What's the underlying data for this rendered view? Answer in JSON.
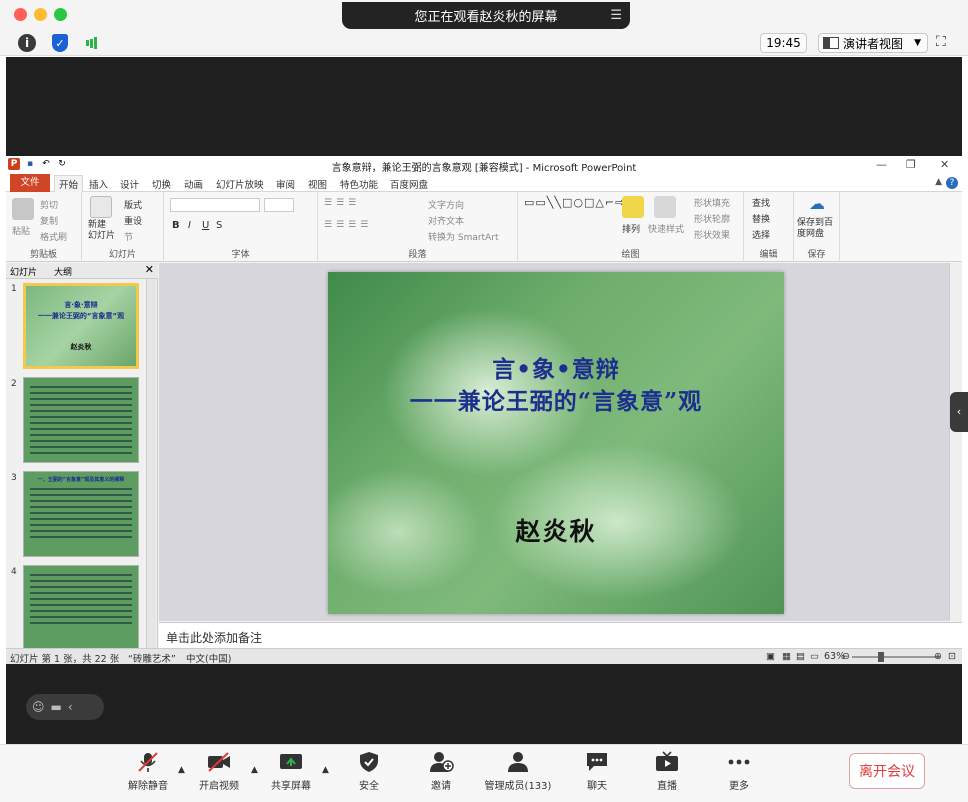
{
  "zoom": {
    "share_banner": "您正在观看赵炎秋的屏幕",
    "clock": "19:45",
    "view_mode": "演讲者视图",
    "leave_label": "离开会议",
    "controls": {
      "unmute": "解除静音",
      "start_video": "开启视频",
      "share_screen": "共享屏幕",
      "security": "安全",
      "invite": "邀请",
      "participants": "管理成员(133)",
      "chat": "聊天",
      "live": "直播",
      "more": "更多"
    }
  },
  "ppt": {
    "doc_title": "言象意辩，兼论王弼的言象意观 [兼容模式] - Microsoft PowerPoint",
    "tabs": {
      "file": "文件",
      "home": "开始",
      "insert": "插入",
      "design": "设计",
      "transitions": "切换",
      "animations": "动画",
      "slideshow": "幻灯片放映",
      "review": "审阅",
      "view": "视图",
      "features": "特色功能",
      "baidu": "百度网盘"
    },
    "ribbon": {
      "paste": "粘贴",
      "cut": "剪切",
      "copy": "复制",
      "format_painter": "格式刷",
      "clipboard": "剪贴板",
      "new_slide": "新建\n幻灯片",
      "layout": "版式",
      "reset": "重设",
      "section": "节",
      "slides_group": "幻灯片",
      "font_group": "字体",
      "text_direction": "文字方向",
      "align_text": "对齐文本",
      "smartart": "转换为 SmartArt",
      "paragraph_group": "段落",
      "arrange": "排列",
      "quick_styles": "快速样式",
      "shape_fill": "形状填充",
      "shape_outline": "形状轮廓",
      "shape_effects": "形状效果",
      "drawing_group": "绘图",
      "find": "查找",
      "replace": "替换",
      "select": "选择",
      "editing_group": "编辑",
      "save_baidu": "保存到百\n度网盘",
      "save_group": "保存"
    },
    "panel": {
      "tab_slides": "幻灯片",
      "tab_outline": "大纲"
    },
    "thumbs": [
      {
        "num": "1",
        "line1": "言·象·意辩",
        "line2": "一一兼论王弼的“言象意”观",
        "author": "赵炎秋"
      },
      {
        "num": "2"
      },
      {
        "num": "3",
        "heading": "一、王弼的“言象意”观及其意义的阐释"
      },
      {
        "num": "4"
      }
    ],
    "slide": {
      "title_line1": "言•象•意辩",
      "title_line2": "一一兼论王弼的“言象意”观",
      "author": "赵炎秋"
    },
    "notes_placeholder": "单击此处添加备注",
    "status": {
      "slide_info": "幻灯片 第 1 张，共 22 张",
      "theme": "“砖雕艺术”",
      "language": "中文(中国)",
      "zoom": "63%"
    }
  }
}
